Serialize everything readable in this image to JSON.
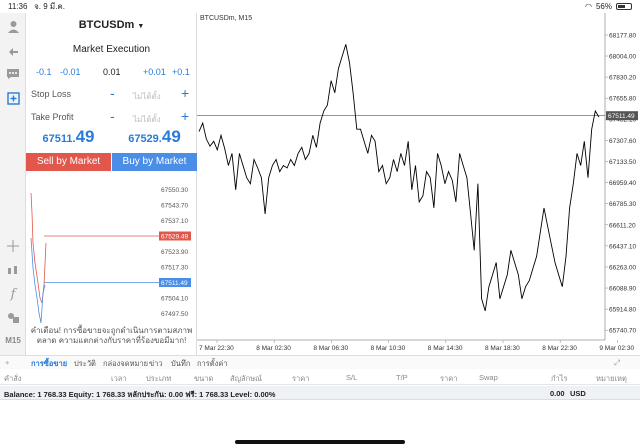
{
  "status": {
    "time": "11:36",
    "date": "จ. 9 มี.ค.",
    "battery": "56%"
  },
  "panel": {
    "symbol": "BTCUSDm",
    "dropdown_icon": "triangle-down",
    "execution": "Market Execution",
    "lots": {
      "m1": "-0.1",
      "m2": "-0.01",
      "value": "0.01",
      "p1": "+0.01",
      "p2": "+0.1"
    },
    "stop_loss": {
      "label": "Stop Loss",
      "minus": "-",
      "placeholder": "ไม่ได้ตั้ง",
      "plus": "+"
    },
    "take_profit": {
      "label": "Take Profit",
      "minus": "-",
      "placeholder": "ไม่ได้ตั้ง",
      "plus": "+"
    },
    "bid": {
      "prefix": "67511.",
      "big": "49"
    },
    "ask": {
      "prefix": "67529.",
      "big": "49"
    },
    "sell_label": "Sell by Market",
    "buy_label": "Buy by Market",
    "mini_levels": [
      "67550.30",
      "67543.70",
      "67537.10",
      "67529.49",
      "67523.90",
      "67517.30",
      "67511.49",
      "67504.10",
      "67497.50"
    ],
    "warning": "คำเตือน! การซื้อขายจะถูกดำเนินการตามสภาพตลาด ความแตกต่างกับราคาที่ร้องขอมีมาก!"
  },
  "chart": {
    "title": "BTCUSDm, M15",
    "price_label": "67511.49",
    "y_ticks": [
      "68177.80",
      "68004.00",
      "67830.20",
      "67655.80",
      "67482.10",
      "67307.60",
      "67133.50",
      "66959.40",
      "66785.30",
      "66611.20",
      "66437.10",
      "66263.00",
      "66088.90",
      "65914.80",
      "65740.70"
    ],
    "x_ticks": [
      "7 Mar 22:30",
      "8 Mar 02:30",
      "8 Mar 06:30",
      "8 Mar 10:30",
      "8 Mar 14:30",
      "8 Mar 18:30",
      "8 Mar 22:30",
      "9 Mar 02:30"
    ]
  },
  "chart_data": {
    "type": "line",
    "title": "BTCUSDm, M15",
    "ylim": [
      65660,
      68260
    ],
    "x": [
      "7 Mar 22:30",
      "8 Mar 02:30",
      "8 Mar 06:30",
      "8 Mar 10:30",
      "8 Mar 14:30",
      "8 Mar 18:30",
      "8 Mar 22:30",
      "9 Mar 02:30"
    ],
    "series": [
      {
        "values": [
          67380,
          67450,
          67320,
          67260,
          67300,
          67230,
          67350,
          67240,
          67100,
          67200,
          66900,
          67200,
          67100,
          67000,
          66950,
          67150,
          67080,
          67000,
          66700,
          67000,
          67100,
          67150,
          67050,
          67100,
          67080,
          67150,
          67100,
          67200,
          67250,
          67150,
          67200,
          67350,
          67250,
          67450,
          67550,
          67600,
          67800,
          67700,
          67900,
          68000,
          68100,
          67950,
          67700,
          67400,
          67400,
          67300,
          67200,
          67350,
          67300,
          67050,
          67100,
          66950,
          67000,
          67150,
          67050,
          67200,
          67100,
          67300,
          66900,
          67100,
          66800,
          66850,
          67050,
          67000,
          66750,
          67200,
          67100,
          66950,
          67050,
          66980,
          66800,
          67200,
          67100,
          67000,
          66700,
          66400,
          66950,
          66000,
          65900,
          66100,
          66200,
          66300,
          66000,
          66100,
          66200,
          66400,
          66300,
          66200,
          66000,
          66100,
          66150,
          66250,
          66350,
          66550,
          66750,
          66600,
          66450,
          66300,
          66200,
          66100,
          66350,
          66750,
          66950,
          67200,
          67100,
          67300,
          67000,
          67400,
          67550,
          67500
        ]
      }
    ]
  },
  "tabs": [
    "การซื้อขาย",
    "ประวัติ",
    "กล่องจดหมาย",
    "ข่าว",
    "บันทึก",
    "การตั้งค่า"
  ],
  "table_headers": [
    "คำสั่ง",
    "เวลา",
    "ประเภท",
    "ขนาด",
    "สัญลักษณ์",
    "ราคา",
    "S/L",
    "T/P",
    "ราคา",
    "Swap",
    "กำไร",
    "หมายเหตุ"
  ],
  "balance": {
    "text": "Balance: 1 768.33 Equity: 1 768.33 หลักประกัน: 0.00 ฟรี: 1 768.33 Level: 0.00%",
    "pl": "0.00",
    "currency": "USD"
  }
}
